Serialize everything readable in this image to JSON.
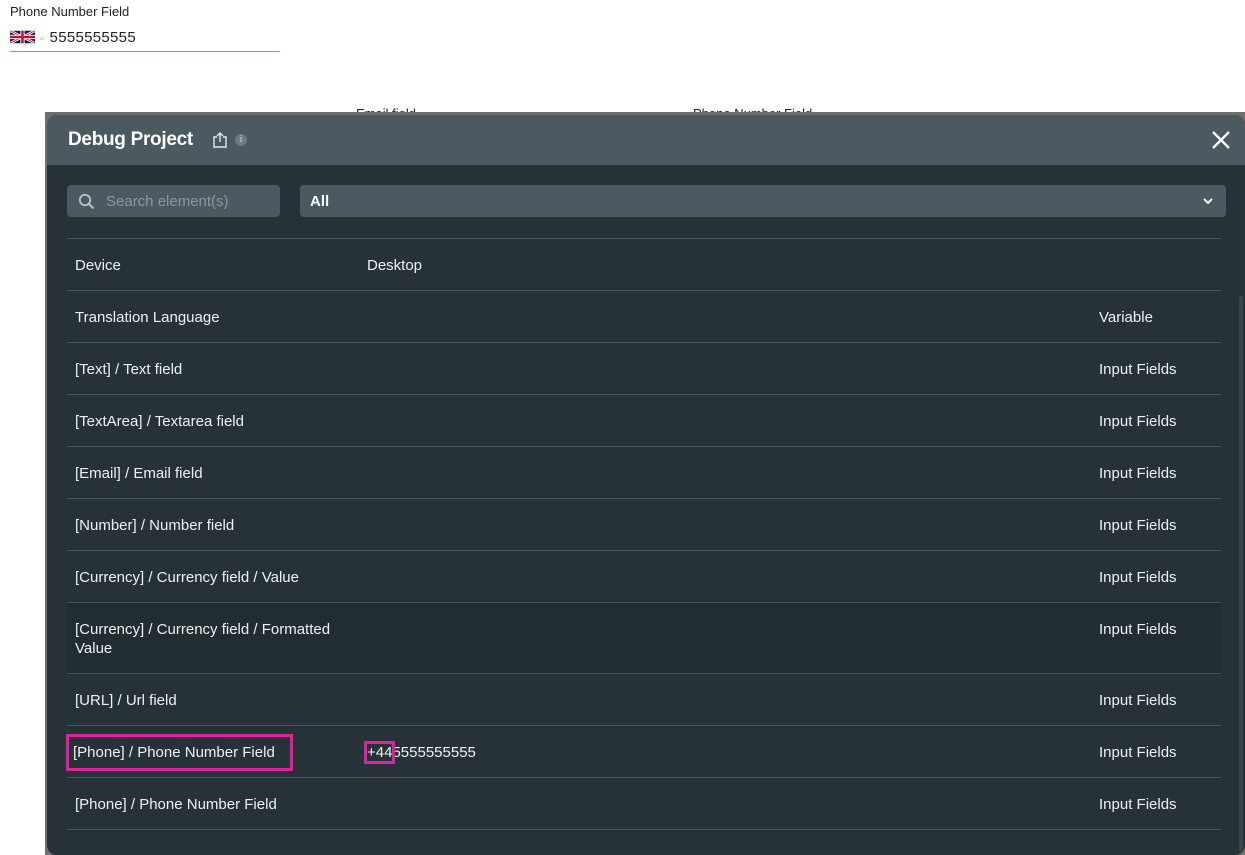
{
  "background_page": {
    "phone_field": {
      "label": "Phone Number Field",
      "country_flag": "uk-flag-icon",
      "value": "5555555555",
      "underline_color": "#2ecc85"
    },
    "peek_labels": [
      "Email field",
      "Phone Number Field"
    ]
  },
  "modal": {
    "title": "Debug Project",
    "icons": [
      "export-icon",
      "info-icon",
      "close-icon"
    ],
    "search": {
      "placeholder": "Search element(s)",
      "value": ""
    },
    "filter": {
      "selected": "All"
    },
    "rows": [
      {
        "name": "Device",
        "value": "Desktop",
        "type": ""
      },
      {
        "name": "Translation Language",
        "value": "",
        "type": "Variable"
      },
      {
        "name": "[Text]  / Text field",
        "value": "",
        "type": "Input Fields"
      },
      {
        "name": "[TextArea]  / Textarea field",
        "value": "",
        "type": "Input Fields"
      },
      {
        "name": "[Email]  / Email field",
        "value": "",
        "type": "Input Fields"
      },
      {
        "name": "[Number]  / Number field",
        "value": "",
        "type": "Input Fields"
      },
      {
        "name": "[Currency]  / Currency field / Value",
        "value": "",
        "type": "Input Fields"
      },
      {
        "name": "[Currency]  / Currency field / Formatted Value",
        "value": "",
        "type": "Input Fields"
      },
      {
        "name": "[URL]  / Url field",
        "value": "",
        "type": "Input Fields"
      },
      {
        "name": "[Phone]  / Phone Number Field",
        "value_prefix": "+44",
        "value": "5555555555",
        "type": "Input Fields"
      },
      {
        "name": "[Phone]  / Phone Number Field",
        "value": "",
        "type": "Input Fields"
      }
    ],
    "annotation_color": "#e0219e"
  }
}
